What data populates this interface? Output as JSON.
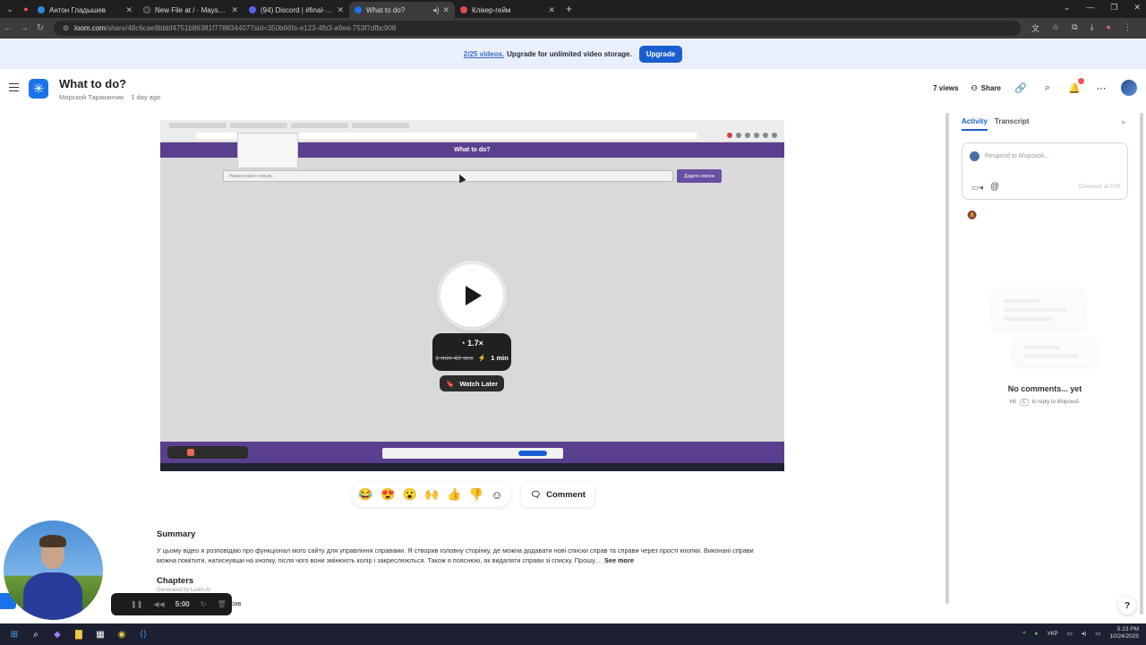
{
  "browser": {
    "tabs": [
      {
        "title": "Антон Гладышев",
        "color": "#2b8ad6",
        "active": false
      },
      {
        "title": "New File at / · Mayschy/fruit-cli",
        "color": "#333333",
        "active": false
      },
      {
        "title": "(94) Discord | #final-project | U",
        "color": "#5865f2",
        "active": false
      },
      {
        "title": "What to do?",
        "color": "#1a73e8",
        "active": true
      },
      {
        "title": "Клікер-гейм",
        "color": "#e04b4b",
        "active": false
      }
    ],
    "url_host": "loom.com",
    "url_path": "/share/48c6cae9bbbf4751b86381f7788344077sid=350b66fa-e123-4fb3-a9ea-753f7dfbc908"
  },
  "banner": {
    "count": "2/25 videos.",
    "message": "Upgrade for unlimited video storage.",
    "button": "Upgrade"
  },
  "header": {
    "title": "What to do?",
    "author": "Морской Тараканчик",
    "time": "1 day ago",
    "views": "7 views",
    "share": "Share"
  },
  "video": {
    "app_title": "What to do?",
    "input_placeholder": "Назва нового списку...",
    "add_button": "Додати список",
    "speed": "1.7×",
    "original_duration": "1 min 42 sec",
    "new_duration": "1 min",
    "watch_later": "Watch Later"
  },
  "reactions": [
    "😂",
    "😍",
    "😮",
    "🙌",
    "👍",
    "👎"
  ],
  "comment_button": "Comment",
  "summary": {
    "heading": "Summary",
    "text": "У цьому відео я розповідаю про функціонал мого сайту для управління справами. Я створив головну сторінку, де можна додавати нові списки справ та справи через прості кнопки. Виконані справи можна помітити, натиснувши на кнопку, після чого вони змінюють колір і закреслюються. Також я пояснюю, як видаляти справи зі списку. Прошу...",
    "see_more": "See more"
  },
  "chapters": {
    "heading": "Chapters",
    "generated": "Generated by Loom AI",
    "first_item_tail": "рав"
  },
  "recorder": {
    "time": "5:00"
  },
  "panel": {
    "tab_activity": "Activity",
    "tab_transcript": "Transcript",
    "respond_placeholder": "Respond to Морской...",
    "comment_at": "Comment at 0:00",
    "no_comments": "No comments... yet",
    "hint_prefix": "Hit",
    "hint_key": "C",
    "hint_suffix": "to reply to Морской."
  },
  "taskbar": {
    "lang": "УКР",
    "time": "5:23 PM",
    "date": "10/24/2025"
  }
}
